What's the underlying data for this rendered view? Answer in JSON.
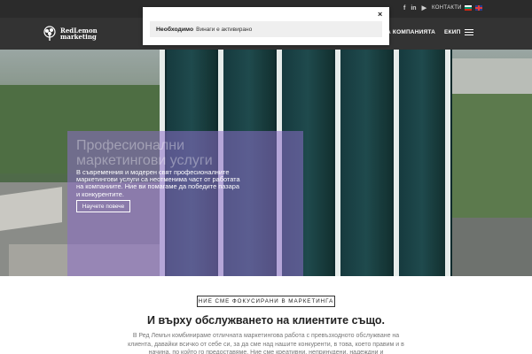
{
  "topbar": {
    "social": [
      "f",
      "in",
      "▶"
    ],
    "contacts_label": "КОНТАКТИ",
    "languages": [
      "bg",
      "en"
    ]
  },
  "nav": {
    "logo_line1": "RedLemon",
    "logo_line2": "marketing",
    "items": [
      "А КОМПАНИЯТА",
      "ЕКИП"
    ]
  },
  "popup": {
    "category": "Необходимо",
    "status": "Винаги е активирано",
    "close_label": "×"
  },
  "hero": {
    "title": "Професионални маркетингови услуги",
    "text": "В съвременния и модерен свят професионалните маркетингови услуги са неотменима част от работата на компаниите. Ние ви помагаме да победите пазара и конкурентите.",
    "button_label": "Научете повече"
  },
  "section": {
    "tag": "НИЕ СМЕ ФОКУСИРАНИ В МАРКЕТИНГА",
    "heading": "И върху обслужването на клиентите също.",
    "paragraph": "В Ред Лемън комбинираме отличната маркетингова работа с превъзходното обслужване на клиента, давайки всичко от себе си, за да сме над нашите конкуренти, в това, което правим и в начина, по който го предоставяме. Ние сме креативни, непринудени, надеждни и"
  },
  "colors": {
    "topbar": "#2b2b2b",
    "navbar": "#333333",
    "overlay": "#8c6ec8"
  }
}
